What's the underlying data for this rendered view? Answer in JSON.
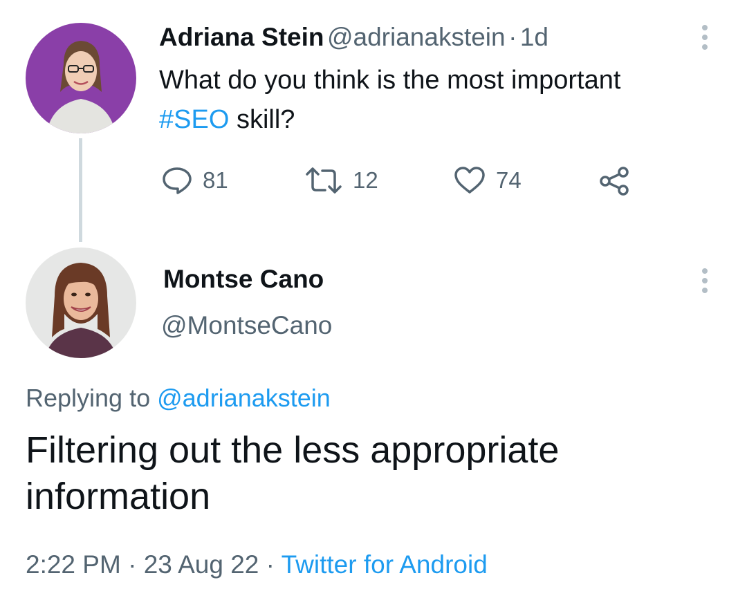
{
  "parent_tweet": {
    "name": "Adriana Stein",
    "handle": "@adrianakstein",
    "separator": "·",
    "age": "1d",
    "text_before": "What do you think is the most important",
    "hashtag": "#SEO",
    "text_after": " skill?",
    "reply_count": "81",
    "retweet_count": "12",
    "like_count": "74"
  },
  "reply_tweet": {
    "name": "Montse Cano",
    "handle": "@MontseCano",
    "replying_prefix": "Replying to ",
    "replying_handle": "@adrianakstein",
    "text": "Filtering out the less appropriate information",
    "time": "2:22 PM",
    "dot1": "·",
    "date": "23 Aug 22",
    "dot2": "·",
    "source": "Twitter for Android"
  },
  "colors": {
    "accent": "#1d9bf0",
    "text": "#0f1419",
    "secondary": "#536471",
    "thread_line": "#cfd9de",
    "avatar1_bg": "#8a3fa8"
  },
  "icons": [
    "reply-icon",
    "retweet-icon",
    "like-icon",
    "share-icon",
    "more-icon"
  ]
}
